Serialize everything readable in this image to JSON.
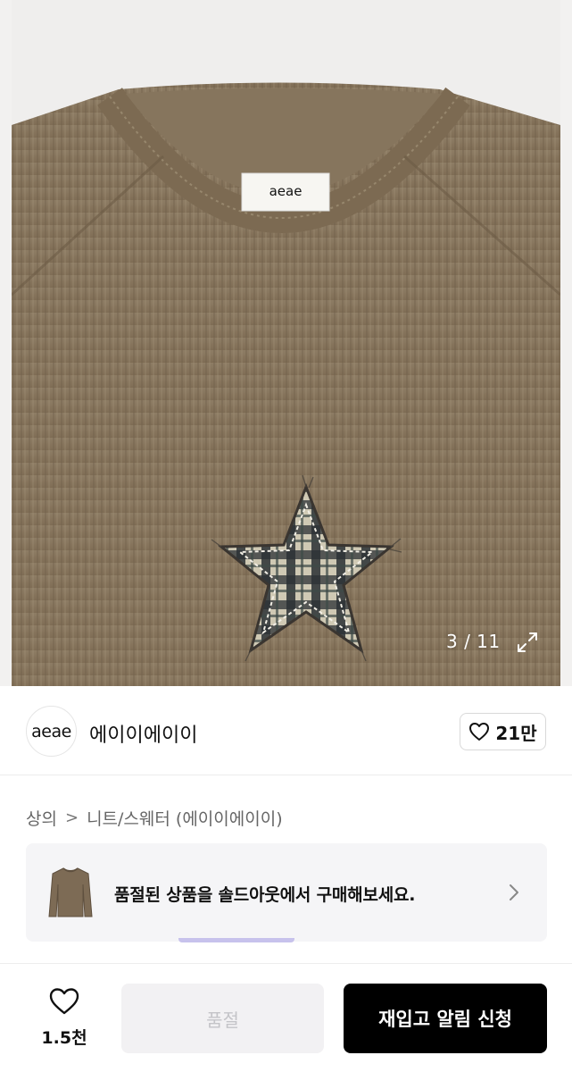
{
  "gallery": {
    "counter": "3 / 11",
    "expand_icon": "expand-icon",
    "label_text": "aeae"
  },
  "brand": {
    "logo_text": "aeae",
    "name": "에이이에이이",
    "likes": "21만",
    "like_icon": "heart-outline-icon"
  },
  "breadcrumb": [
    {
      "label": "상의"
    },
    {
      "label": "니트/스웨터 (에이이에이이)"
    }
  ],
  "banner": {
    "text": "품절된 상품을 솔드아웃에서 구매해보세요.",
    "thumb_icon": "sweater-thumbnail",
    "chevron_icon": "chevron-right-icon"
  },
  "bottom_bar": {
    "wish_count": "1.5천",
    "soldout_label": "품절",
    "restock_label": "재입고 알림 신청"
  },
  "colors": {
    "sweater": "#8a7860",
    "primary_button": "#000000",
    "disabled_button": "#f2f1f3",
    "banner_bg": "#f5f5f7"
  }
}
